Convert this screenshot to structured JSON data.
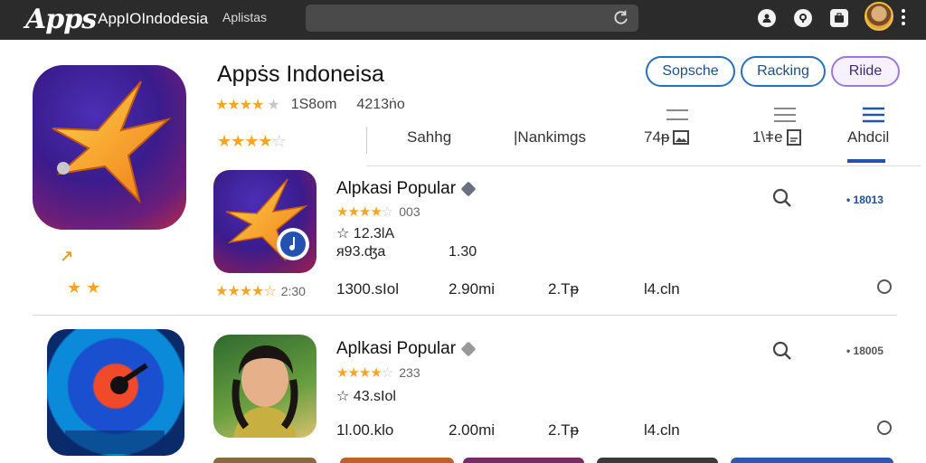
{
  "topbar": {
    "logo_mark": "Apps",
    "logo_text": "AppIOIndodesia",
    "link": "Aplistas",
    "icons": [
      "profile-icon",
      "location-icon",
      "briefcase-icon"
    ],
    "kebab": "⋮"
  },
  "hero": {
    "title": "Appṡs Indoneisa",
    "rating_stars": "★★★★",
    "rating_star_off": "★",
    "meta_a": "1S8om",
    "meta_b": "4213ṅo",
    "stars_line": "★★★★",
    "stars_line_off": "☆",
    "small_arrow": "↗",
    "small_stars": "★ ★"
  },
  "pills": [
    {
      "label": "Sopsche"
    },
    {
      "label": "Racking"
    },
    {
      "label": "Riide"
    }
  ],
  "tabs": [
    {
      "label": "Sahhg"
    },
    {
      "label": "|Nankimgs"
    },
    {
      "label": "74ᵽ"
    },
    {
      "label": "1\\ǂe"
    },
    {
      "label": "Ahdcil"
    }
  ],
  "rows": [
    {
      "title": "Alpkasi Popular",
      "stars": "★★★★",
      "stars_off": "☆",
      "rating_count": "003",
      "line1": "☆ 12.3lA",
      "line2": "ᴙ93.ʤa",
      "line2_value": "1.30",
      "cells": [
        "1300.sIol",
        "2.90mi",
        "2.Tᵽ",
        "l4.cln"
      ],
      "left_rating": "★★★★☆",
      "left_rating_num": "2:30",
      "size": "• 18013"
    },
    {
      "title": "Aplkasi Popular",
      "stars": "★★★★",
      "stars_off": "☆",
      "rating_count": "233",
      "line1": "☆ 43.sIol",
      "cells": [
        "1l.00.klo",
        "2.00mi",
        "2.Tᵽ",
        "l4.cln"
      ],
      "size": "• 18005"
    }
  ],
  "colors": {
    "topbar": "#2b2b2b",
    "accent": "#2452b0",
    "star": "#f2a52c"
  }
}
